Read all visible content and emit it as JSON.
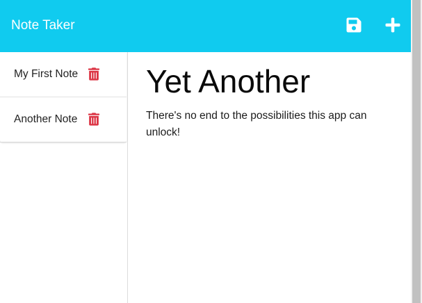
{
  "navbar": {
    "brand": "Note Taker",
    "save_icon": "save-icon",
    "new_icon": "plus-icon"
  },
  "notes": [
    {
      "title": "My First Note",
      "delete_icon": "trash-icon"
    },
    {
      "title": "Another Note",
      "delete_icon": "trash-icon"
    }
  ],
  "active_note": {
    "title": "Yet Another",
    "text": "There's no end to the possibilities this app can unlock!"
  },
  "colors": {
    "navbar": "#10cbef",
    "delete": "#dc3545",
    "icon": "#ffffff"
  }
}
